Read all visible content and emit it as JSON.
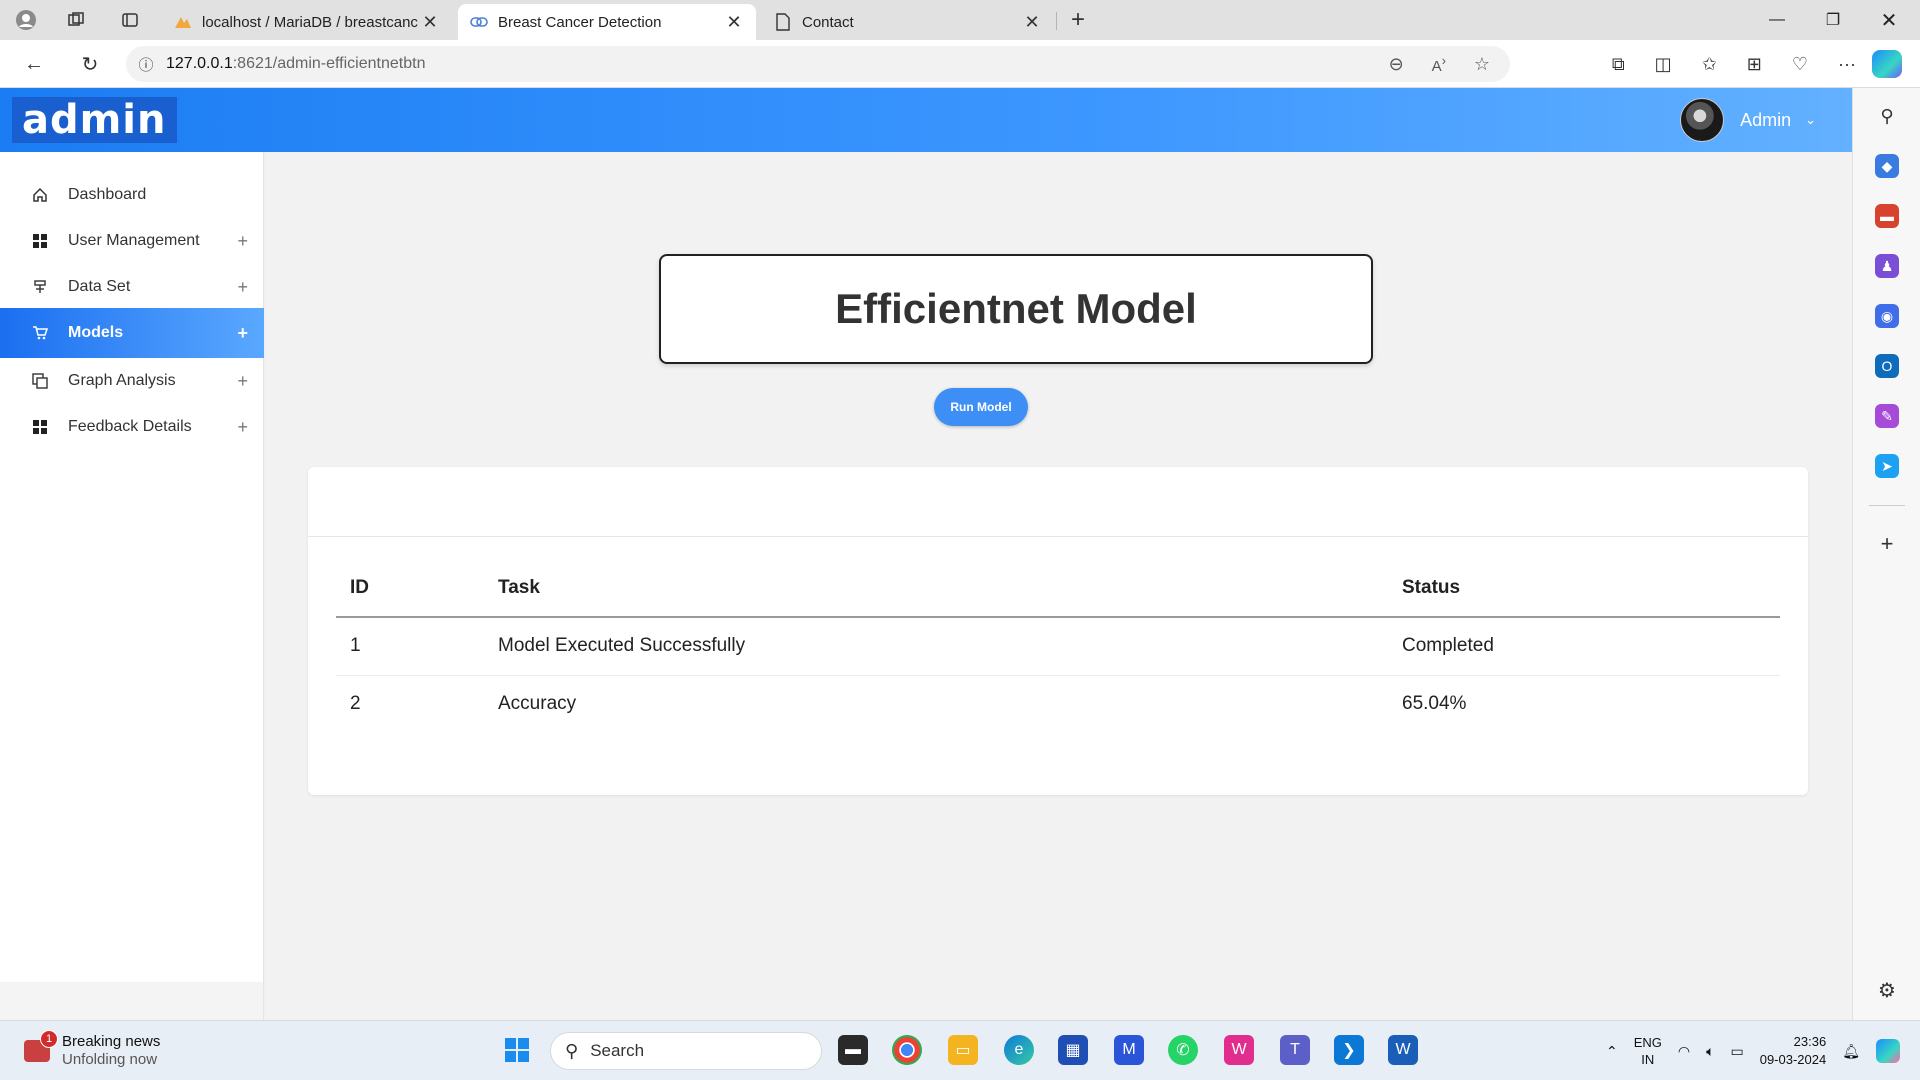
{
  "browser": {
    "tabs": [
      {
        "title": "localhost / MariaDB / breastcanc",
        "favicon": "phpmyadmin-icon"
      },
      {
        "title": "Breast Cancer Detection",
        "favicon": "link-icon"
      },
      {
        "title": "Contact",
        "favicon": "page-icon"
      }
    ],
    "url_host": "127.0.0.1",
    "url_path": ":8621/admin-efficientnetbtn"
  },
  "header": {
    "logo": "admin",
    "user_name": "Admin"
  },
  "sidebar": {
    "items": [
      {
        "label": "Dashboard",
        "icon": "home-icon",
        "expandable": false
      },
      {
        "label": "User Management",
        "icon": "grid-icon",
        "expandable": true
      },
      {
        "label": "Data Set",
        "icon": "dataset-icon",
        "expandable": true
      },
      {
        "label": "Models",
        "icon": "cart-icon",
        "expandable": true,
        "active": true
      },
      {
        "label": "Graph Analysis",
        "icon": "copy-icon",
        "expandable": true
      },
      {
        "label": "Feedback Details",
        "icon": "grid-icon",
        "expandable": true
      }
    ]
  },
  "main": {
    "title": "Efficientnet Model",
    "run_button": "Run Model",
    "table": {
      "headers": [
        "ID",
        "Task",
        "Status"
      ],
      "rows": [
        [
          "1",
          "Model Executed Successfully",
          "Completed"
        ],
        [
          "2",
          "Accuracy",
          "65.04%"
        ]
      ]
    }
  },
  "taskbar": {
    "news_title": "Breaking news",
    "news_subtitle": "Unfolding now",
    "news_badge": "1",
    "search_label": "Search",
    "lang_line1": "ENG",
    "lang_line2": "IN",
    "time": "23:36",
    "date": "09-03-2024"
  },
  "colors": {
    "header_start": "#1b7df3",
    "header_end": "#63b1ff",
    "run_button": "#3d8ff5",
    "active_sidebar": "#1b6ff0"
  }
}
